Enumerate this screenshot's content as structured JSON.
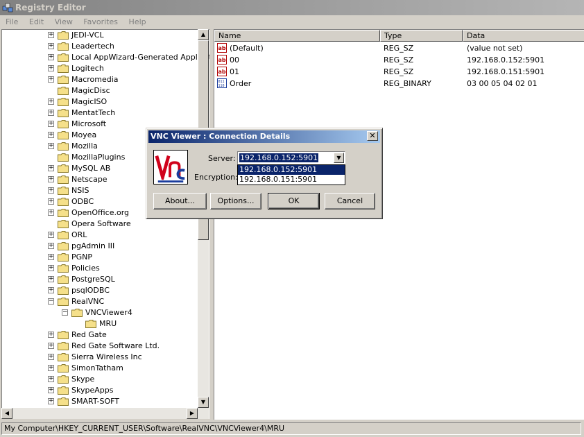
{
  "window": {
    "title": "Registry Editor",
    "menu": [
      "File",
      "Edit",
      "View",
      "Favorites",
      "Help"
    ]
  },
  "tree": {
    "items": [
      {
        "label": "JEDI-VCL",
        "expander": "+"
      },
      {
        "label": "Leadertech",
        "expander": "+"
      },
      {
        "label": "Local AppWizard-Generated Applicatio",
        "expander": "+"
      },
      {
        "label": "Logitech",
        "expander": "+"
      },
      {
        "label": "Macromedia",
        "expander": "+"
      },
      {
        "label": "MagicDisc",
        "expander": ""
      },
      {
        "label": "MagicISO",
        "expander": "+"
      },
      {
        "label": "MentatTech",
        "expander": "+"
      },
      {
        "label": "Microsoft",
        "expander": "+"
      },
      {
        "label": "Moyea",
        "expander": "+"
      },
      {
        "label": "Mozilla",
        "expander": "+"
      },
      {
        "label": "MozillaPlugins",
        "expander": ""
      },
      {
        "label": "MySQL AB",
        "expander": "+"
      },
      {
        "label": "Netscape",
        "expander": "+"
      },
      {
        "label": "NSIS",
        "expander": "+"
      },
      {
        "label": "ODBC",
        "expander": "+"
      },
      {
        "label": "OpenOffice.org",
        "expander": "+"
      },
      {
        "label": "Opera Software",
        "expander": ""
      },
      {
        "label": "ORL",
        "expander": "+"
      },
      {
        "label": "pgAdmin III",
        "expander": "+"
      },
      {
        "label": "PGNP",
        "expander": "+"
      },
      {
        "label": "Policies",
        "expander": "+"
      },
      {
        "label": "PostgreSQL",
        "expander": "+"
      },
      {
        "label": "psqlODBC",
        "expander": "+"
      },
      {
        "label": "RealVNC",
        "expander": "-"
      },
      {
        "label": "VNCViewer4",
        "expander": "-"
      },
      {
        "label": "MRU",
        "expander": ""
      },
      {
        "label": "Red Gate",
        "expander": "+"
      },
      {
        "label": "Red Gate Software Ltd.",
        "expander": "+"
      },
      {
        "label": "Sierra Wireless Inc",
        "expander": "+"
      },
      {
        "label": "SimonTatham",
        "expander": "+"
      },
      {
        "label": "Skype",
        "expander": "+"
      },
      {
        "label": "SkypeApps",
        "expander": "+"
      },
      {
        "label": "SMART-SOFT",
        "expander": "+"
      }
    ]
  },
  "list": {
    "columns": [
      "Name",
      "Type",
      "Data"
    ],
    "rows": [
      {
        "name": "(Default)",
        "type": "REG_SZ",
        "data": "(value not set)",
        "icon": "string-value-icon"
      },
      {
        "name": "00",
        "type": "REG_SZ",
        "data": "192.168.0.152:5901",
        "icon": "string-value-icon"
      },
      {
        "name": "01",
        "type": "REG_SZ",
        "data": "192.168.0.151:5901",
        "icon": "string-value-icon"
      },
      {
        "name": "Order",
        "type": "REG_BINARY",
        "data": "03 00 05 04 02 01",
        "icon": "binary-value-icon"
      }
    ]
  },
  "status": {
    "path": "My Computer\\HKEY_CURRENT_USER\\Software\\RealVNC\\VNCViewer4\\MRU"
  },
  "dialog": {
    "title": "VNC Viewer : Connection Details",
    "server_label": "Server:",
    "server_value": "192.168.0.152:5901",
    "encryption_label": "Encryption:",
    "dropdown_options": [
      "192.168.0.152:5901",
      "192.168.0.151:5901"
    ],
    "buttons": {
      "about": "About...",
      "options": "Options...",
      "ok": "OK",
      "cancel": "Cancel"
    }
  },
  "colors": {
    "selection": "#0a246a",
    "face": "#d4d0c8",
    "folder": "#f5e08a",
    "vnc_red": "#d0021b",
    "vnc_blue": "#1a3c9c"
  }
}
